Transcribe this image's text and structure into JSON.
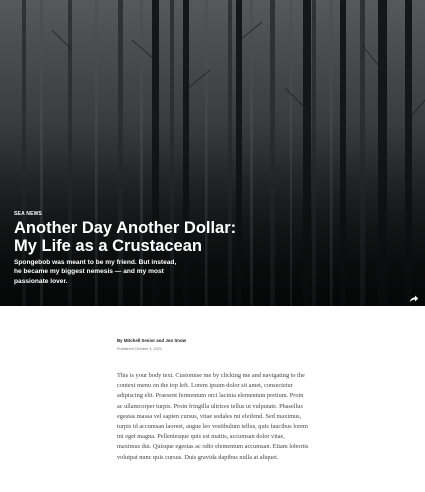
{
  "hero": {
    "category": "SEA NEWS",
    "title": "Another Day Another Dollar: My Life as a Crustacean",
    "subtitle": "Spongebob was meant to be my friend. But instead, he became my biggest nemesis — and my most passionate lover.",
    "share_icon": "share-arrow-icon"
  },
  "article": {
    "byline_prefix": "By",
    "authors": "Mitchell Senior and Jon Snow",
    "published": "Published October 3, 2021",
    "body": "This is your body text. Customise me by clicking me and navigating to the context menu on the top left. Lorem ipsum dolor sit amet, consectetur adipiscing elit. Praesent fermentum orci lacinia elementum pretium. Proin ac ullamcorper turpis. Proin fringilla ultrices tellus ut vulputate. Phasellus egestas massa vel sapien cursus, vitae sodales mi eleifend. Sed maximus, turpis id accumsan laoreet, augue leo vestibulum tellus, quis faucibus lorem mi eget magna. Pellentesque quis est mattis, accumsan dolor vitae, maximus dui. Quisque egestas ac odio elementum accumsan. Etiam lobortis volutpat nunc quis cursus. Duis gravida dapibus nulla at aliquet."
  }
}
